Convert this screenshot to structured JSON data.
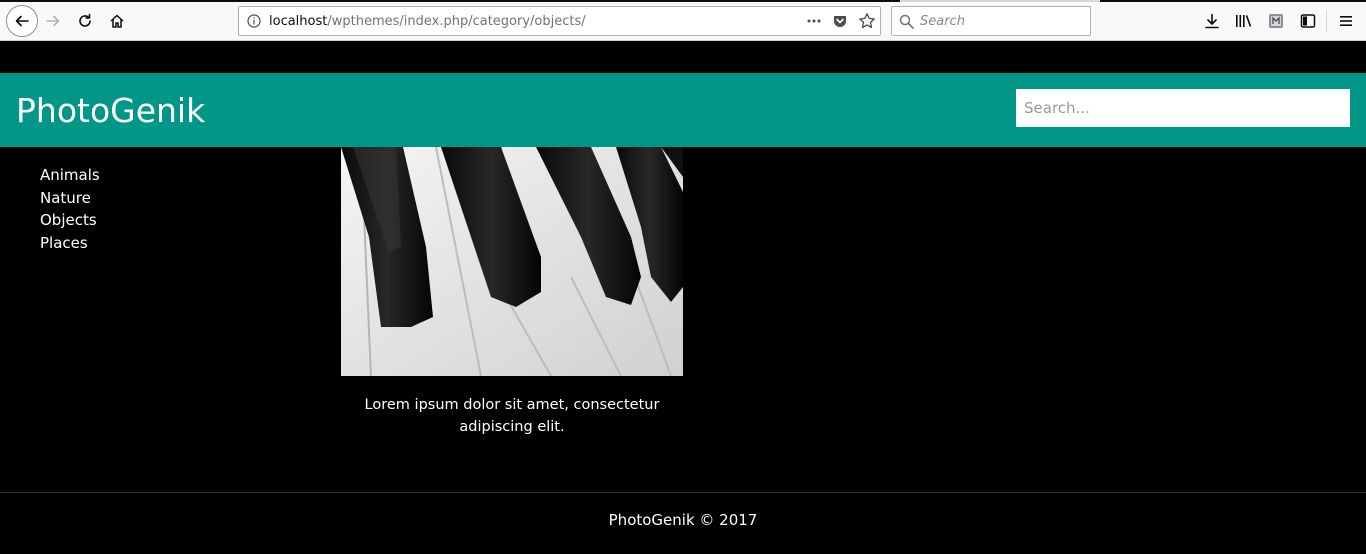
{
  "browser": {
    "url_host": "localhost",
    "url_path": "/wpthemes/index.php/category/objects/",
    "search_placeholder": "Search",
    "icons": {
      "back": "back-arrow-icon",
      "forward": "forward-arrow-icon",
      "reload": "reload-icon",
      "home": "home-icon",
      "info": "info-icon",
      "more": "more-dots-icon",
      "pocket": "pocket-icon",
      "bookmark": "star-icon",
      "search": "search-icon",
      "download": "download-icon",
      "library": "library-icon",
      "extension": "extension-icon",
      "sidebar": "sidebar-icon",
      "menu": "hamburger-menu-icon"
    }
  },
  "site": {
    "title": "PhotoGenik",
    "search_placeholder": "Search...",
    "brand_color": "#009688",
    "categories": [
      "Animals",
      "Nature",
      "Objects",
      "Places"
    ],
    "post": {
      "image_subject": "piano-keys",
      "caption": "Lorem ipsum dolor sit amet, consectetur adipiscing elit."
    },
    "footer": "PhotoGenik © 2017"
  }
}
